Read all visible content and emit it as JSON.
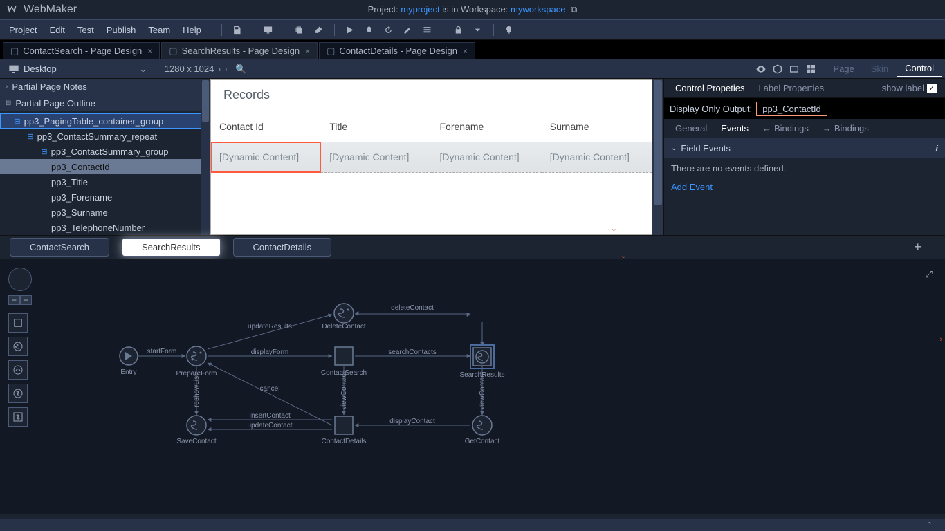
{
  "app": {
    "title": "WebMaker"
  },
  "projectInfo": {
    "prefix": "Project: ",
    "project": "myproject",
    "mid": " is in Workspace: ",
    "workspace": "myworkspace"
  },
  "menu": [
    "Project",
    "Edit",
    "Test",
    "Publish",
    "Team",
    "Help"
  ],
  "fileTabs": [
    {
      "label": "ContactSearch - Page Design",
      "active": false
    },
    {
      "label": "SearchResults - Page Design",
      "active": true
    },
    {
      "label": "ContactDetails - Page Design",
      "active": false
    }
  ],
  "viewport": {
    "device": "Desktop",
    "resolution": "1280 x 1024"
  },
  "sideTabs": {
    "page": "Page",
    "skin": "Skin",
    "control": "Control"
  },
  "leftPanel": {
    "notesHeader": "Partial Page Notes",
    "outlineHeader": "Partial Page Outline",
    "tree": [
      {
        "label": "pp3_PagingTable_container_group",
        "ind": 1,
        "sel": true,
        "toggle": "⊟"
      },
      {
        "label": "pp3_ContactSummary_repeat",
        "ind": 2,
        "toggle": "⊟"
      },
      {
        "label": "pp3_ContactSummary_group",
        "ind": 3,
        "toggle": "⊟"
      },
      {
        "label": "pp3_ContactId",
        "ind": 4,
        "hilite": true
      },
      {
        "label": "pp3_Title",
        "ind": 4
      },
      {
        "label": "pp3_Forename",
        "ind": 4
      },
      {
        "label": "pp3_Surname",
        "ind": 4
      },
      {
        "label": "pp3_TelephoneNumber",
        "ind": 4
      }
    ]
  },
  "canvas": {
    "title": "Records",
    "columns": [
      "Contact Id",
      "Title",
      "Forename",
      "Surname"
    ],
    "row": [
      "[Dynamic Content]",
      "[Dynamic Content]",
      "[Dynamic Content]",
      "[Dynamic Content]"
    ]
  },
  "rightPanel": {
    "tabs": {
      "controlProps": "Control Propeties",
      "labelProps": "Label Properties",
      "showLabel": "show label"
    },
    "fieldLabel": "Display Only Output:",
    "fieldValue": "pp3_ContactId",
    "subtabs": {
      "general": "General",
      "events": "Events",
      "bindingsIn": "Bindings",
      "bindingsOut": "Bindings"
    },
    "section": "Field Events",
    "noEvents": "There are no events defined.",
    "addEvent": "Add Event"
  },
  "flowTabs": [
    "ContactSearch",
    "SearchResults",
    "ContactDetails"
  ],
  "flow": {
    "nodes": {
      "entry": "Entry",
      "prepare": "PrepareForm",
      "contactSearch": "ContactSearch",
      "searchResults": "SearchResults",
      "deleteContact": "DeleteContact",
      "saveContact": "SaveContact",
      "contactDetails": "ContactDetails",
      "getContact": "GetContact"
    },
    "edges": {
      "startForm": "startForm",
      "displayForm": "displayForm",
      "updateResults": "updateResults",
      "cancel": "cancel",
      "searchContacts": "searchContacts",
      "deleteContact": "deleteContact",
      "viewContactR": "viewContact",
      "viewContactL": "viewContact",
      "reshowList": "reshowList",
      "insertContact": "InsertContact",
      "updateContact": "updateContact",
      "displayContact": "displayContact"
    }
  }
}
